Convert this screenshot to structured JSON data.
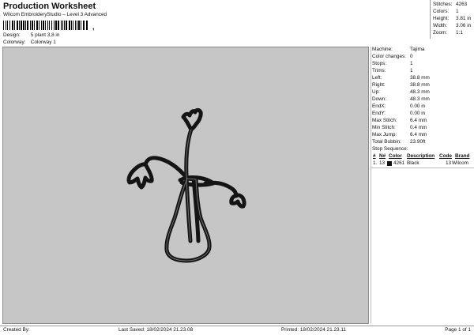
{
  "header": {
    "title": "Production Worksheet",
    "subtitle": "Wilcom EmbroideryStudio – Level 3 Advanced",
    "barcode_tail": ",",
    "design_label": "Design:",
    "design_value": "5 plant 3,8 in",
    "colorway_label": "Colorway:",
    "colorway_value": "Colorway 1"
  },
  "header_stats": [
    {
      "label": "Stitches:",
      "value": "4263"
    },
    {
      "label": "Colors:",
      "value": "1"
    },
    {
      "label": "Height:",
      "value": "3.81 in"
    },
    {
      "label": "Width:",
      "value": "3.06 in"
    },
    {
      "label": "Zoom:",
      "value": "1:1"
    }
  ],
  "panel": {
    "rows": [
      {
        "label": "Machine:",
        "value": "Tajima"
      },
      {
        "label": "Color changes:",
        "value": "0"
      },
      {
        "label": "Stops:",
        "value": "1"
      },
      {
        "label": "Trims:",
        "value": "1"
      },
      {
        "label": "Left:",
        "value": "38.8 mm"
      },
      {
        "label": "Right:",
        "value": "38.8 mm"
      },
      {
        "label": "Up:",
        "value": "48.3 mm"
      },
      {
        "label": "Down:",
        "value": "48.3 mm"
      },
      {
        "label": "EndX:",
        "value": "0.00 in"
      },
      {
        "label": "EndY:",
        "value": "0.00 in"
      },
      {
        "label": "Max Stitch:",
        "value": "6.4 mm"
      },
      {
        "label": "Min Stitch:",
        "value": "0.4 mm"
      },
      {
        "label": "Max Jump:",
        "value": "6.4 mm"
      },
      {
        "label": "Total Bobbin:",
        "value": "23.90ft"
      }
    ],
    "stop_sequence_title": "Stop Sequence:",
    "columns": {
      "num": "#",
      "n": "N#",
      "color": "Color",
      "description": "Description",
      "code": "Code",
      "brand": "Brand"
    },
    "stops": [
      {
        "num": "1.",
        "n": "13",
        "stitches": "4261",
        "description": "Black",
        "code": "13",
        "brand": "Wilcom",
        "color": "#141414"
      }
    ]
  },
  "footer": {
    "created_by": "Created By:",
    "last_saved": "Last Saved: 18/02/2024 21.23.08",
    "printed": "Printed: 18/02/2024 21.23.11",
    "page": "Page 1 of 1"
  },
  "colors": {
    "canvas_bg": "#c6c6c6",
    "thread": "#141414"
  }
}
